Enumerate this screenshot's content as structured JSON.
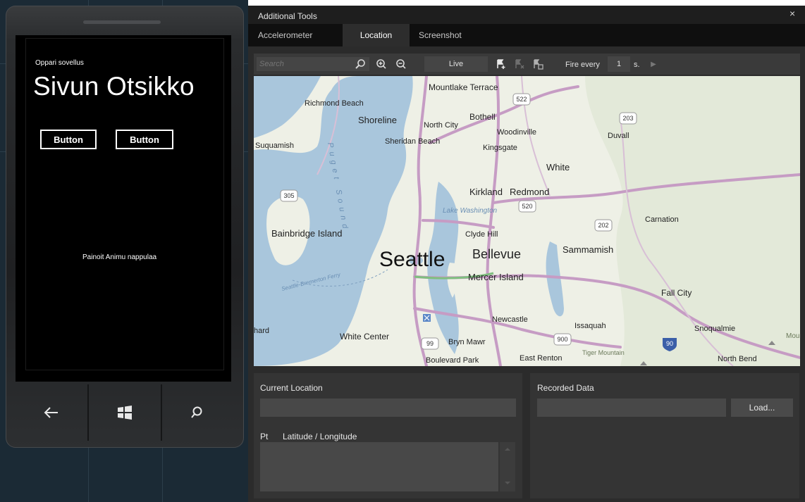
{
  "phone": {
    "app_title": "Oppari sovellus",
    "page_title": "Sivun Otsikko",
    "buttons": [
      "Button",
      "Button"
    ],
    "status_text": "Painoit Animu nappulaa",
    "hardware_keys": [
      "back-icon",
      "windows-logo-icon",
      "search-icon"
    ]
  },
  "tools": {
    "window_title": "Additional Tools",
    "close_glyph": "×",
    "tabs": [
      {
        "label": "Accelerometer",
        "active": false
      },
      {
        "label": "Location",
        "active": true
      },
      {
        "label": "Screenshot",
        "active": false
      }
    ],
    "toolbar": {
      "search_placeholder": "Search",
      "mode": "Live",
      "fire_label": "Fire every",
      "fire_value": "1",
      "fire_unit": "s."
    },
    "map_labels": {
      "cities": [
        "Mountlake Terrace",
        "Richmond Beach",
        "Shoreline",
        "North City",
        "Bothell",
        "Woodinville",
        "Duvall",
        "Sheridan Beach",
        "Kingsgate",
        "Suquamish",
        "White",
        "Kirkland",
        "Redmond",
        "Lake Washington",
        "Carnation",
        "Bainbridge Island",
        "Clyde Hill",
        "Seattle",
        "Bellevue",
        "Sammamish",
        "Mercer Island",
        "Fall City",
        "Newcastle",
        "Issaquah",
        "Snoqualmie",
        "hard",
        "White Center",
        "Bryn Mawr",
        "Boulevard Park",
        "East Renton",
        "Tiger Mountain",
        "North Bend",
        "Mou",
        "Puget Sound",
        "Seattle-Bremerton Ferry"
      ],
      "route_shields": [
        "522",
        "203",
        "305",
        "520",
        "202",
        "900",
        "99",
        "90"
      ]
    },
    "current_location": {
      "title": "Current Location",
      "value": "",
      "columns": [
        "Pt",
        "Latitude / Longitude"
      ]
    },
    "recorded_data": {
      "title": "Recorded Data",
      "value": "",
      "load_label": "Load..."
    },
    "colors": {
      "water": "#a9c6dc",
      "land": "#eef0e6",
      "highway": "#c69cc4",
      "accent_dark": "#2b2b2b"
    }
  }
}
